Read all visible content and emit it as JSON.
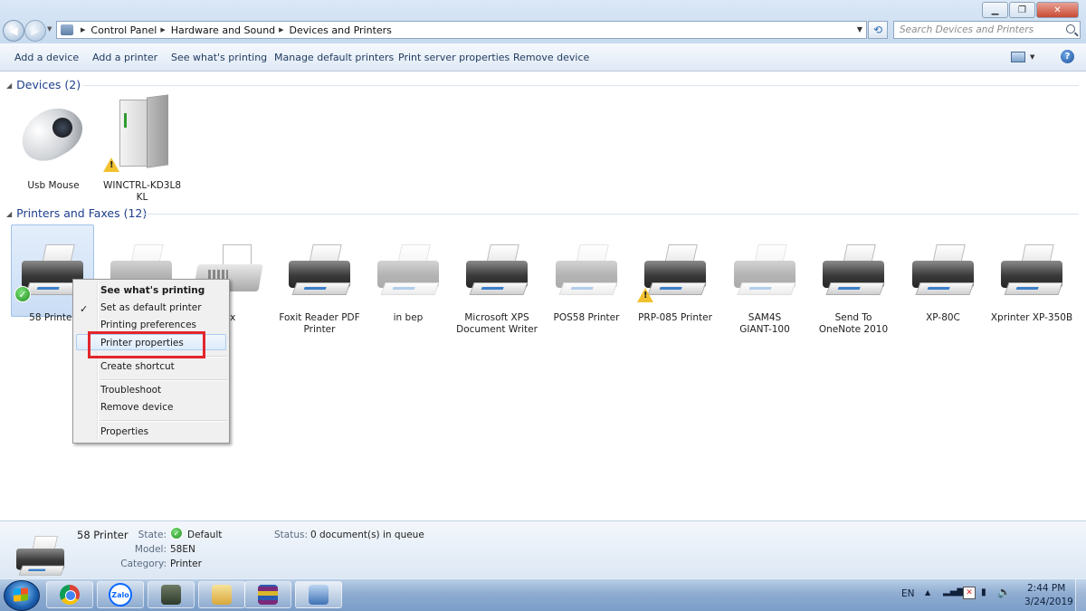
{
  "window": {
    "btn_min": "▁",
    "btn_max": "❐",
    "btn_close": "✕"
  },
  "address": {
    "crumbs": [
      "Control Panel",
      "Hardware and Sound",
      "Devices and Printers"
    ]
  },
  "search": {
    "placeholder": "Search Devices and Printers"
  },
  "toolbar": {
    "add_device": "Add a device",
    "add_printer": "Add a printer",
    "see_printing": "See what's printing",
    "manage_default": "Manage default printers",
    "print_server": "Print server properties",
    "remove_device": "Remove device",
    "help": "?"
  },
  "devices": {
    "header": "Devices (2)",
    "items": [
      {
        "label": "Usb Mouse"
      },
      {
        "label": "WINCTRL-KD3L8\nKL"
      }
    ]
  },
  "printers": {
    "header": "Printers and Faxes (12)",
    "items": [
      {
        "label": "58 Printer",
        "status": "default"
      },
      {
        "label": ""
      },
      {
        "label": "ax"
      },
      {
        "label": "Foxit Reader PDF\nPrinter"
      },
      {
        "label": "in bep"
      },
      {
        "label": "Microsoft XPS\nDocument Writer"
      },
      {
        "label": "POS58 Printer"
      },
      {
        "label": "PRP-085 Printer",
        "status": "warning"
      },
      {
        "label": "SAM4S\nGIANT-100"
      },
      {
        "label": "Send To\nOneNote 2010"
      },
      {
        "label": "XP-80C"
      },
      {
        "label": "Xprinter XP-350B"
      }
    ]
  },
  "context_menu": {
    "items": [
      "See what's printing",
      "Set as default printer",
      "Printing preferences",
      "Printer properties",
      "Create shortcut",
      "Troubleshoot",
      "Remove device",
      "Properties"
    ],
    "check": "✓"
  },
  "details": {
    "name": "58 Printer",
    "state_label": "State:",
    "state_value": "Default",
    "model_label": "Model:",
    "model_value": "58EN",
    "category_label": "Category:",
    "category_value": "Printer",
    "status_label": "Status:",
    "status_value": "0 document(s) in queue"
  },
  "taskbar": {
    "zalo": "Zalo",
    "lang": "EN",
    "time": "2:44 PM",
    "date": "3/24/2019"
  },
  "colors": {
    "accent_header": "#1e3f8c",
    "highlight_red": "#e3262c",
    "selection": "#c9ddf5"
  }
}
